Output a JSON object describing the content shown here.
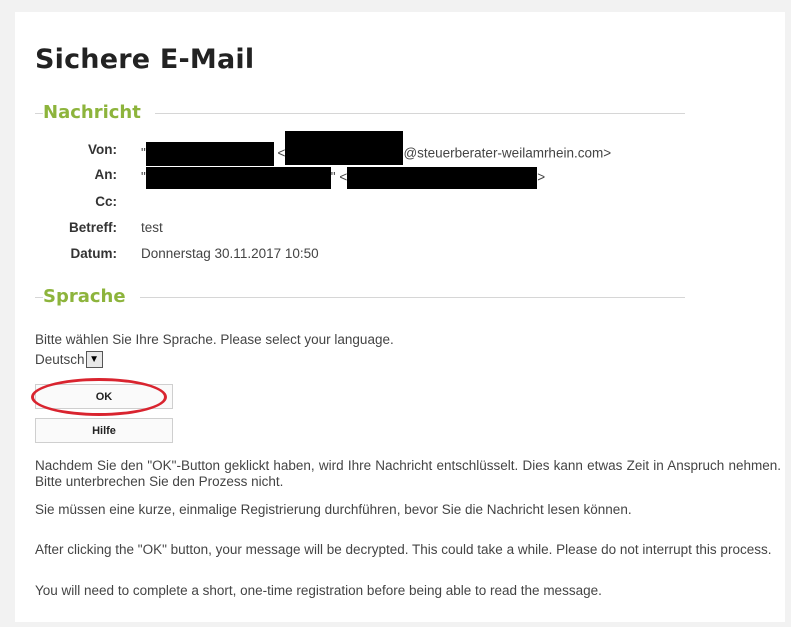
{
  "page": {
    "title": "Sichere E-Mail"
  },
  "message_section": {
    "heading": "Nachricht",
    "from_label": "Von:",
    "from_suffix": "@steuerberater-weilamrhein.com>",
    "to_label": "An:",
    "cc_label": "Cc:",
    "subject_label": "Betreff:",
    "subject_value": "test",
    "date_label": "Datum:",
    "date_value": "Donnerstag 30.11.2017 10:50"
  },
  "language_section": {
    "heading": "Sprache",
    "prompt": "Bitte wählen Sie Ihre Sprache. Please select your language.",
    "selected_language": "Deutsch"
  },
  "buttons": {
    "ok_label": "OK",
    "help_label": "Hilfe"
  },
  "info": {
    "de_paragraph_1": "Nachdem Sie den \"OK\"-Button geklickt haben, wird Ihre Nachricht entschlüsselt. Dies kann etwas Zeit in Anspruch nehmen. Bitte unterbrechen Sie den Prozess nicht.",
    "de_paragraph_2": "Sie müssen eine kurze, einmalige Registrierung durchführen, bevor Sie die Nachricht lesen können.",
    "en_paragraph_1": "After clicking the \"OK\" button, your message will be decrypted. This could take a while. Please do not interrupt this process.",
    "en_paragraph_2": "You will need to complete a short, one-time registration before being able to read the message."
  },
  "colors": {
    "accent_green": "#8db43c",
    "highlight_red": "#d9242f"
  }
}
